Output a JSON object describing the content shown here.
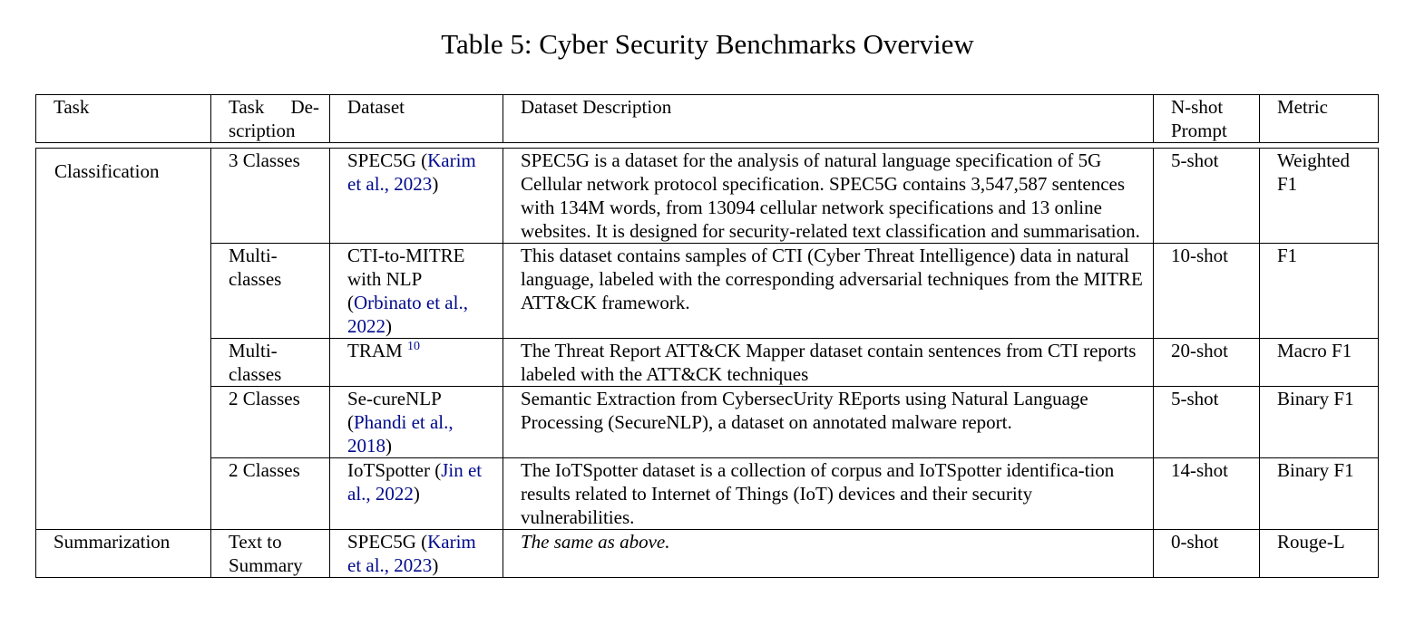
{
  "caption": "Table 5: Cyber Security Benchmarks Overview",
  "headers": {
    "task": "Task",
    "task_desc_1": "Task De-",
    "task_desc_2": "scription",
    "dataset": "Dataset",
    "dataset_desc": "Dataset Description",
    "nshot_1": "N-shot",
    "nshot_2": "Prompt",
    "metric": "Metric"
  },
  "rows": [
    {
      "task": "Classification",
      "task_desc": "3 Classes",
      "dataset_name": "SPEC5G (",
      "dataset_cite": "Karim et al., 2023",
      "dataset_close": ")",
      "description": "SPEC5G is a dataset for the analysis of natural language specification of 5G Cellular network protocol specification. SPEC5G contains 3,547,587 sentences with 134M words, from 13094 cellular network specifications and 13 online websites. It is designed for security-related text classification and summarisation.",
      "nshot": "5-shot",
      "metric": "Weighted F1"
    },
    {
      "task_desc": "Multi-classes",
      "dataset_name": "CTI-to-MITRE with NLP (",
      "dataset_cite": "Orbinato et al., 2022",
      "dataset_close": ")",
      "description": "This dataset contains samples of CTI (Cyber Threat Intelligence) data in natural language, labeled with the corresponding adversarial techniques from the MITRE ATT&CK framework.",
      "nshot": "10-shot",
      "metric": "F1"
    },
    {
      "task_desc": "Multi-classes",
      "dataset_name": "TRAM",
      "dataset_sup": "10",
      "description": "The Threat Report ATT&CK Mapper dataset contain sentences from CTI reports labeled with the ATT&CK techniques",
      "nshot": "20-shot",
      "metric": "Macro F1"
    },
    {
      "task_desc": "2 Classes",
      "dataset_name": "Se-cureNLP (",
      "dataset_cite": "Phandi et al., 2018",
      "dataset_close": ")",
      "description": "Semantic Extraction from CybersecUrity REports using Natural Language Processing (SecureNLP), a dataset on annotated malware report.",
      "nshot": "5-shot",
      "metric": "Binary F1"
    },
    {
      "task_desc": "2 Classes",
      "dataset_name": "IoTSpotter (",
      "dataset_cite": "Jin et al., 2022",
      "dataset_close": ")",
      "description": "The IoTSpotter dataset is a collection of corpus and IoTSpotter identifica-tion results related to Internet of Things (IoT) devices and their security vulnerabilities.",
      "nshot": "14-shot",
      "metric": "Binary F1"
    },
    {
      "task": "Summarization",
      "task_desc": "Text to Summary",
      "dataset_name": "SPEC5G (",
      "dataset_cite": "Karim et al., 2023",
      "dataset_close": ")",
      "description": "The same as above.",
      "nshot": "0-shot",
      "metric": "Rouge-L"
    }
  ]
}
